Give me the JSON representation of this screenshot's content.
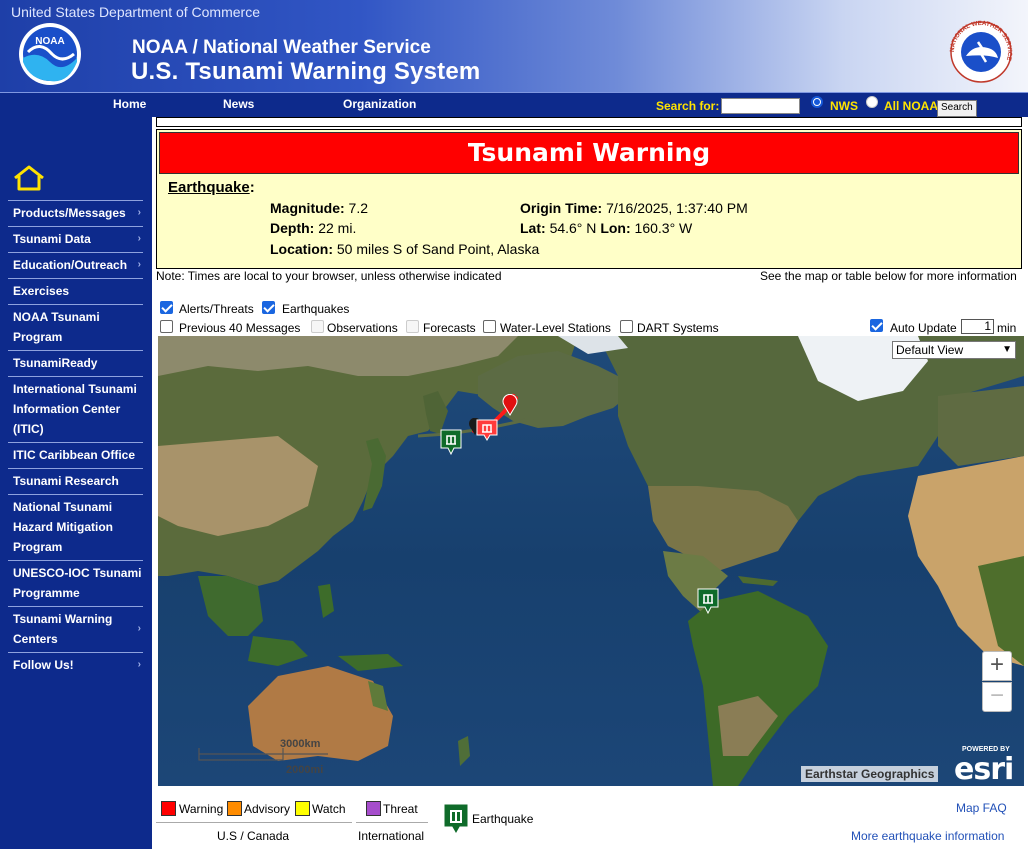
{
  "header": {
    "department": "United States Department of Commerce",
    "org": "NOAA / National Weather Service",
    "system": "U.S. Tsunami Warning System",
    "noaa_logo_text": "NOAA",
    "nws_logo_text": "NATIONAL WEATHER SERVICE"
  },
  "nav": {
    "links": [
      "Home",
      "News",
      "Organization"
    ],
    "search_label": "Search for:",
    "search_value": "",
    "radio_options": [
      "NWS",
      "All NOAA"
    ],
    "radio_selected": "NWS",
    "search_button": "Search"
  },
  "sidebar": {
    "items": [
      {
        "label": "Products/Messages",
        "arrow": true
      },
      {
        "label": "Tsunami Data",
        "arrow": true
      },
      {
        "label": "Education/Outreach",
        "arrow": true
      },
      {
        "label": "Exercises",
        "arrow": false
      },
      {
        "label": "NOAA Tsunami Program",
        "arrow": false
      },
      {
        "label": "TsunamiReady",
        "arrow": false
      },
      {
        "label": "International Tsunami Information Center (ITIC)",
        "arrow": false
      },
      {
        "label": "ITIC Caribbean Office",
        "arrow": false
      },
      {
        "label": "Tsunami Research",
        "arrow": false
      },
      {
        "label": "National Tsunami Hazard Mitigation Program",
        "arrow": false
      },
      {
        "label": "UNESCO-IOC Tsunami Programme",
        "arrow": false
      },
      {
        "label": "Tsunami Warning Centers",
        "arrow": true
      },
      {
        "label": "Follow Us!",
        "arrow": true
      }
    ]
  },
  "alert": {
    "headline": "Tsunami Warning",
    "section_title": "Earthquake",
    "magnitude_label": "Magnitude:",
    "magnitude": "7.2",
    "origin_time_label": "Origin Time:",
    "origin_time": "7/16/2025, 1:37:40 PM",
    "depth_label": "Depth:",
    "depth": "22 mi.",
    "lat_label": "Lat:",
    "lat": "54.6° N",
    "lon_label": "Lon:",
    "lon": "160.3° W",
    "location_label": "Location:",
    "location": "50 miles S of Sand Point, Alaska",
    "note_left": "Note: Times are local to your browser, unless otherwise indicated",
    "note_right": "See the map or table below for more information"
  },
  "layers": {
    "alerts_threats": {
      "label": "Alerts/Threats",
      "checked": true
    },
    "earthquakes": {
      "label": "Earthquakes",
      "checked": true
    },
    "previous_40": {
      "label": "Previous 40 Messages",
      "checked": false
    },
    "observations": {
      "label": "Observations",
      "checked": false,
      "disabled": true
    },
    "forecasts": {
      "label": "Forecasts",
      "checked": false,
      "disabled": true
    },
    "water_level": {
      "label": "Water-Level Stations",
      "checked": false
    },
    "dart": {
      "label": "DART Systems",
      "checked": false
    },
    "auto_update": {
      "label": "Auto Update",
      "checked": true,
      "value": "1",
      "unit": "min"
    }
  },
  "map": {
    "view_select": "Default View",
    "zoom_in": "+",
    "zoom_out": "−",
    "scale_km": "3000km",
    "scale_mi": "2000mi",
    "attribution": "Earthstar Geographics",
    "powered_by": "POWERED BY",
    "esri": "esri"
  },
  "legend": {
    "warning": {
      "label": "Warning",
      "color": "#ff0000"
    },
    "advisory": {
      "label": "Advisory",
      "color": "#ff8c00"
    },
    "watch": {
      "label": "Watch",
      "color": "#ffff00"
    },
    "threat": {
      "label": "Threat",
      "color": "#a64dcc"
    },
    "region_us": "U.S / Canada",
    "region_intl": "International",
    "earthquake": "Earthquake"
  },
  "links": {
    "map_faq": "Map FAQ",
    "more_eq": "More earthquake information"
  },
  "colors": {
    "nav_blue": "#0d2a8c",
    "alert_bg": "#ffffc8",
    "alert_red": "#ff0000",
    "link_blue": "#2251b8"
  }
}
